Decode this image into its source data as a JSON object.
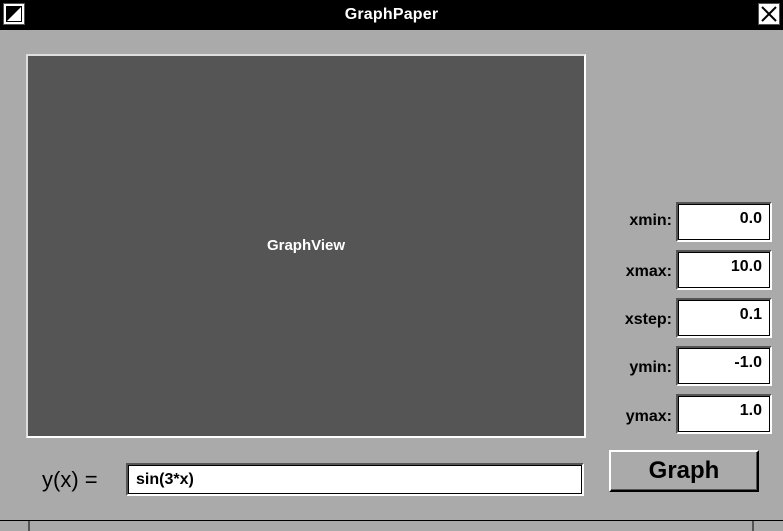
{
  "window": {
    "title": "GraphPaper"
  },
  "titlebar": {
    "miniaturize_icon": "miniaturize-icon",
    "close_icon": "close-icon"
  },
  "graph_view": {
    "label": "GraphView",
    "background": "#555555"
  },
  "params": [
    {
      "label": "xmin:",
      "value": "0.0"
    },
    {
      "label": "xmax:",
      "value": "10.0"
    },
    {
      "label": "xstep:",
      "value": "0.1"
    },
    {
      "label": "ymin:",
      "value": "-1.0"
    },
    {
      "label": "ymax:",
      "value": "1.0"
    }
  ],
  "expression": {
    "label": "y(x) =",
    "value": "sin(3*x)"
  },
  "graph_button": {
    "label": "Graph"
  },
  "colors": {
    "window_bg": "#aaaaaa",
    "titlebar_bg": "#000000",
    "view_bg": "#555555"
  }
}
